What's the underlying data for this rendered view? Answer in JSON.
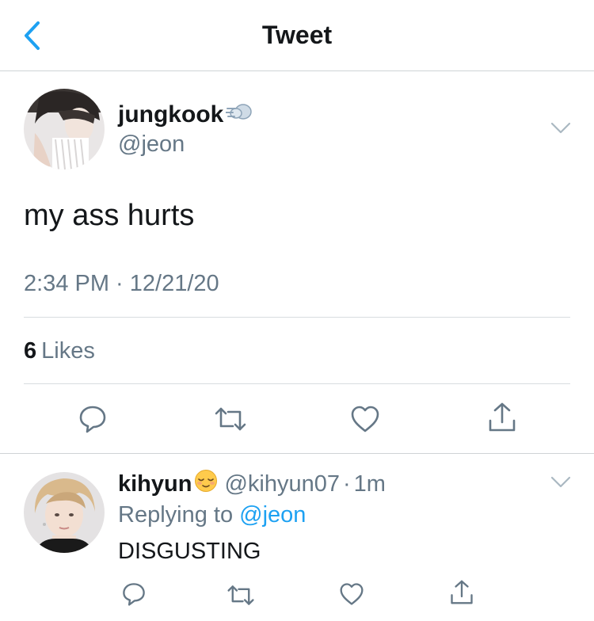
{
  "header": {
    "title": "Tweet",
    "back_icon": "chevron-left-icon"
  },
  "tweet": {
    "author_name": "jungkook",
    "author_emoji": "💨",
    "author_handle": "@jeon",
    "text": "my ass hurts",
    "timestamp": "2:34 PM · 12/21/20",
    "likes_count": "6",
    "likes_label": "Likes",
    "actions": [
      "reply-icon",
      "retweet-icon",
      "like-icon",
      "share-icon"
    ]
  },
  "reply": {
    "author_name": "kihyun",
    "author_emoji": "😌",
    "author_handle": "@kihyun07",
    "separator": "·",
    "time": "1m",
    "replying_label": "Replying to",
    "replying_to": "@jeon",
    "text": "DISGUSTING",
    "actions": [
      "reply-icon",
      "retweet-icon",
      "like-icon",
      "share-icon"
    ]
  },
  "colors": {
    "accent": "#1da1f2",
    "muted": "#657786",
    "text": "#14171a",
    "divider": "#d8dcdf"
  }
}
